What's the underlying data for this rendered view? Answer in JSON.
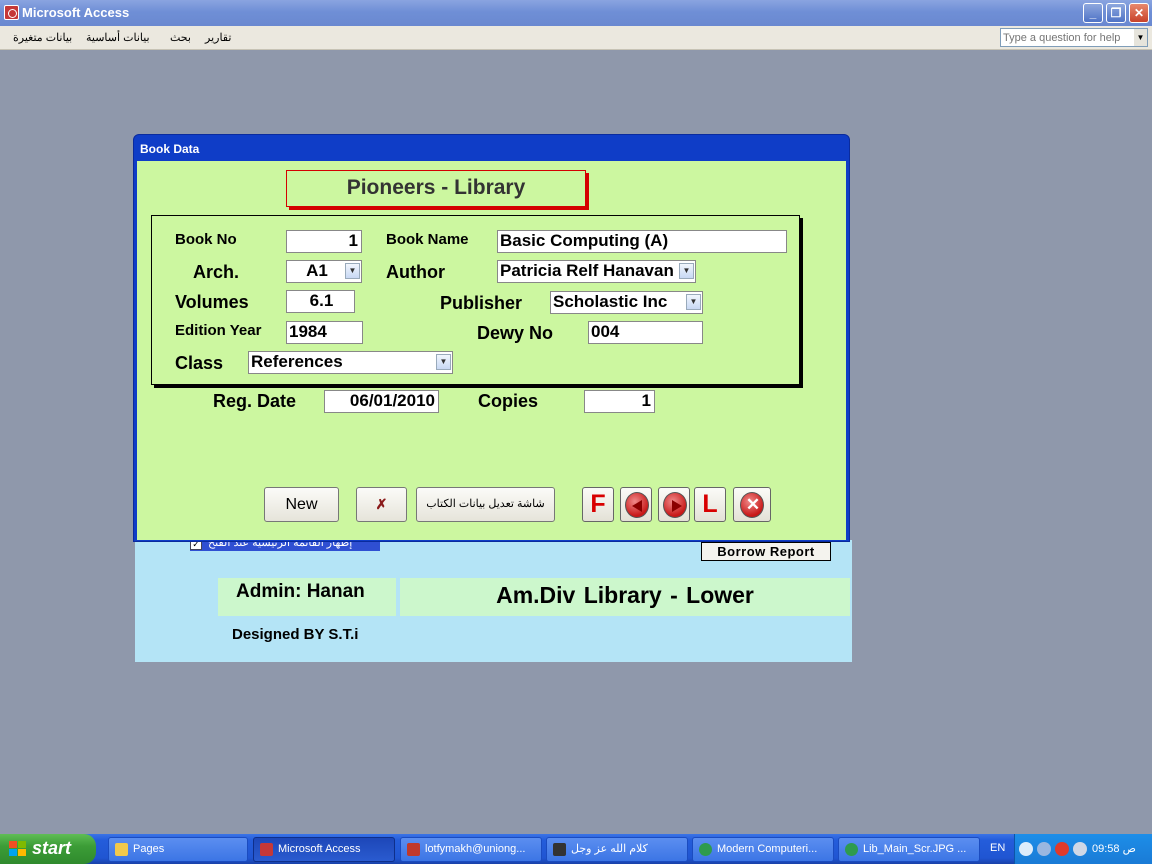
{
  "window": {
    "title": "Microsoft Access",
    "minimize": "_",
    "restore": "❐",
    "close": "✕"
  },
  "menu": {
    "items": [
      "تقارير",
      "بحث",
      "بيانات أساسية",
      "بيانات متغيرة"
    ],
    "help_placeholder": "Type a question for help",
    "help_arrow": "▼"
  },
  "book_form": {
    "title": "Book Data",
    "header": "Pioneers - Library",
    "labels": {
      "book_no": "Book No",
      "book_name": "Book Name",
      "arch": "Arch.",
      "author": "Author",
      "volumes": "Volumes",
      "publisher": "Publisher",
      "edition_year": "Edition Year",
      "dewy_no": "Dewy No",
      "class": "Class",
      "reg_date": "Reg. Date",
      "copies": "Copies"
    },
    "values": {
      "book_no": "1",
      "book_name": "Basic Computing (A)",
      "arch": "A1",
      "author": "Patricia Relf Hanavan",
      "volumes": "6.1",
      "publisher": "Scholastic Inc",
      "edition_year": "1984",
      "dewy_no": "004",
      "class": "References",
      "reg_date": "06/01/2010",
      "copies": "1"
    },
    "buttons": {
      "new": "New",
      "undo": "✗",
      "edit_screen": "شاشة تعديل بيانات الكتاب",
      "first": "F",
      "last": "L"
    }
  },
  "main_form": {
    "startup_checkbox": "إظهار القائمة الرئيسية عند الفتح",
    "borrow_report": "Borrow Report",
    "admin": "Admin: Hanan",
    "library": "Am.Div  Library - Lower",
    "designed_by": "Designed BY S.T.i"
  },
  "taskbar": {
    "start": "start",
    "tasks": [
      {
        "label": "Pages",
        "color": "#f2c94c"
      },
      {
        "label": "Microsoft Access",
        "color": "#c53838"
      },
      {
        "label": "lotfymakh@uniong...",
        "color": "#c0392b"
      },
      {
        "label": "كلام الله عز وجل",
        "color": "#333333"
      },
      {
        "label": "Modern Computeri...",
        "color": "#2e9b4e"
      },
      {
        "label": "Lib_Main_Scr.JPG ...",
        "color": "#2e9b4e"
      }
    ],
    "lang": "EN",
    "clock": "09:58 ص"
  },
  "colors": {
    "form_green": "#ccf7a0",
    "main_blue": "#b4e4f6",
    "label_green": "#ccf7cc",
    "accent_red": "#d40000",
    "title_blue": "#0f3dc7"
  }
}
